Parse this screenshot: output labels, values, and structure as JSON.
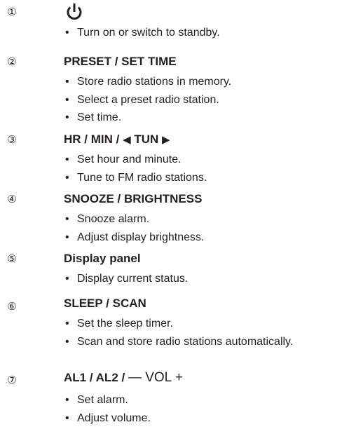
{
  "sections": [
    {
      "number": "①",
      "icon": "power-icon",
      "bullets": [
        "Turn on or switch to standby."
      ]
    },
    {
      "number": "②",
      "title": "PRESET / SET TIME",
      "bullets": [
        "Store radio stations in memory.",
        "Select a preset radio station.",
        "Set time."
      ]
    },
    {
      "number": "③",
      "title_parts": [
        "HR / MIN / ",
        "◀",
        " TUN ",
        "▶"
      ],
      "bullets": [
        "Set hour and minute.",
        "Tune to FM radio stations."
      ]
    },
    {
      "number": "④",
      "title": "SNOOZE / BRIGHTNESS",
      "bullets": [
        "Snooze alarm.",
        "Adjust display brightness."
      ]
    },
    {
      "number": "⑤",
      "title": "Display panel",
      "bullets": [
        "Display current status."
      ]
    },
    {
      "number": "⑥",
      "title": "SLEEP / SCAN",
      "bullets": [
        "Set the sleep timer.",
        "Scan and store radio stations automatically."
      ]
    },
    {
      "number": "⑦",
      "title_parts": [
        "AL1 / AL2 / ",
        "— VOL +"
      ],
      "bullets": [
        "Set alarm.",
        "Adjust volume."
      ]
    }
  ],
  "colors": {
    "text": "#231f20",
    "background": "#ffffff"
  }
}
